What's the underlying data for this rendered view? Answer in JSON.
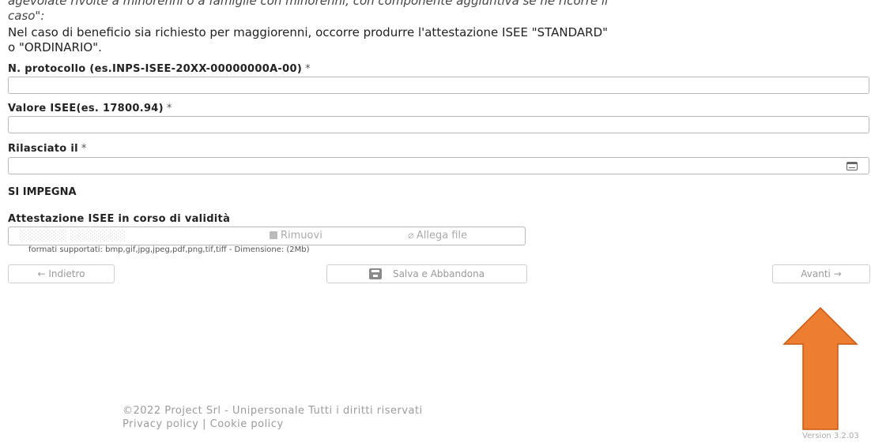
{
  "intro": {
    "cut_line": "agevolate rivolte a minorenni o a famiglie con minorenni, con componente aggiuntiva se ne ricorre il",
    "cut_caso": "caso\":",
    "line1": "Nel caso di beneficio sia richiesto per maggiorenni, occorre produrre l'attestazione ISEE \"STANDARD\"",
    "line2": "o \"ORDINARIO\"."
  },
  "fields": {
    "protocollo_label": "N. protocollo (es.INPS-ISEE-20XX-00000000A-00)",
    "protocollo_value": "",
    "isee_label": "Valore ISEE(es. 17800.94)",
    "isee_value": "",
    "rilasciato_label": "Rilasciato il",
    "rilasciato_value": "",
    "required_mark": "*"
  },
  "section_title": "SI IMPEGNA",
  "attestazione": {
    "label": "Attestazione ISEE in corso di validità",
    "remove_label": "Rimuovi",
    "attach_label": "Allega file",
    "hint": "formati supportati: bmp,gif,jpg,jpeg,pdf,png,tif,tiff - Dimensione: (2Mb)"
  },
  "nav": {
    "back_label": "← Indietro",
    "save_label": "Salva e Abbandona",
    "next_label": "Avanti →"
  },
  "footer": {
    "copyright": "©2022 Project Srl - Unipersonale Tutti i diritti riservati",
    "links": "Privacy policy | Cookie policy",
    "version": "Version 3.2.03"
  },
  "annotation": {
    "arrow_color": "#ed7d31",
    "arrow_stroke": "#c55a11"
  },
  "icons": [
    "calendar-icon",
    "trash-icon",
    "paperclip-icon",
    "save-icon"
  ]
}
